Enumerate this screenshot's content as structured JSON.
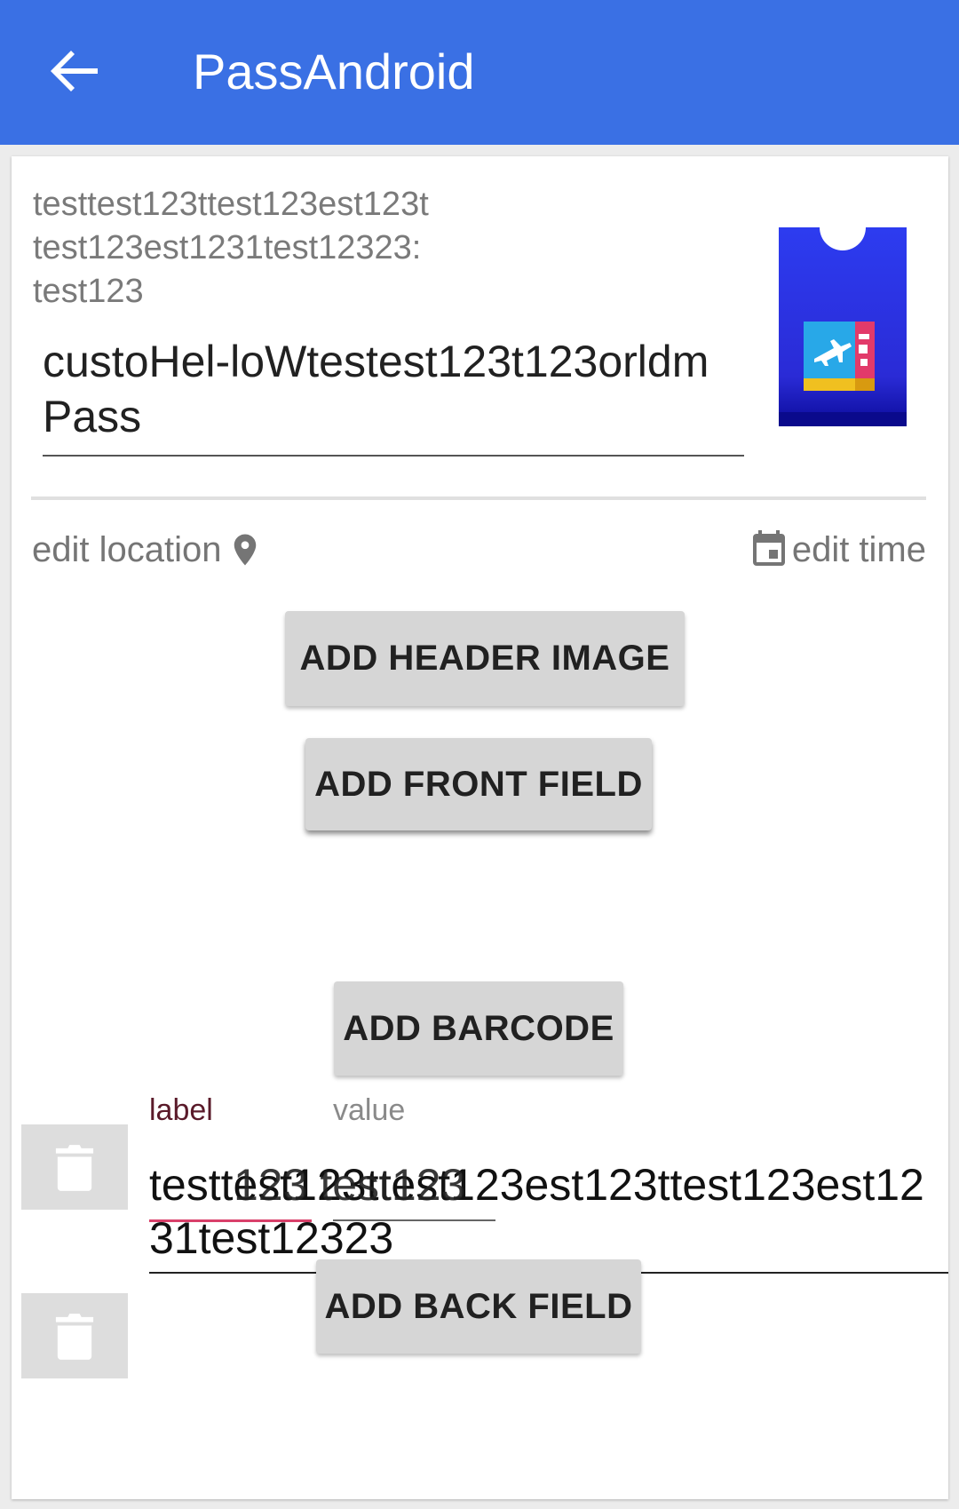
{
  "app_bar": {
    "title": "PassAndroid",
    "back_icon": "arrow-back-icon",
    "color": "#3a70e4"
  },
  "pass": {
    "description": "testtest123ttest123est123t test123est1231test12323: test123",
    "name": "custoHel-loWtestest123t123orldm Pass",
    "image_icon": "boarding-pass-icon"
  },
  "actions": {
    "edit_location": "edit location",
    "edit_time": "edit time",
    "location_icon": "location-pin-icon",
    "time_icon": "calendar-icon"
  },
  "buttons": {
    "add_header_image": "ADD HEADER IMAGE",
    "add_front_field": "ADD FRONT FIELD",
    "add_barcode": "ADD BARCODE",
    "add_back_field": "ADD BACK FIELD"
  },
  "field": {
    "label_caption": "label",
    "value_caption": "value",
    "label_text": "testtest123ttest123est123ttest123est1231test12323",
    "value_overlap_text": "123 test123",
    "delete_icon": "trash-icon"
  }
}
